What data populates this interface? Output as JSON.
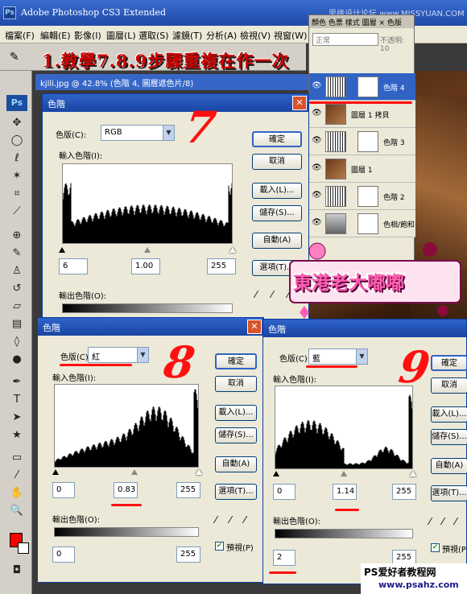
{
  "app": {
    "title": "Adobe Photoshop CS3 Extended",
    "watermark_top": "思缘设计论坛 www.MISSYUAN.COM",
    "ps_logo": "Ps"
  },
  "menu": [
    "檔案(F)",
    "編輯(E)",
    "影像(I)",
    "圖層(L)",
    "選取(S)",
    "濾鏡(T)",
    "分析(A)",
    "檢視(V)",
    "視窗(W)"
  ],
  "banner": "1.教學7.8.9步驟重複在作一次",
  "document": {
    "tab_title": "kjlli.jpg @ 42.8% (色階 4, 圖層遮色片/8)"
  },
  "layers_panel": {
    "tabs": "顏色  色票  樣式  圖層 × 色版",
    "blend_mode": "正常",
    "opacity_label": "不透明: 10",
    "layers": [
      {
        "name": "色階 4",
        "kind": "adjustment",
        "selected": true
      },
      {
        "name": "圖層 1 拷貝",
        "kind": "photo",
        "selected": false
      },
      {
        "name": "色階 3",
        "kind": "adjustment",
        "selected": false
      },
      {
        "name": "圖層 1",
        "kind": "photo",
        "selected": false
      },
      {
        "name": "色階 2",
        "kind": "adjustment",
        "selected": false
      },
      {
        "name": "色相/飽和",
        "kind": "adjustment",
        "selected": false
      }
    ]
  },
  "dialog7": {
    "title": "色階",
    "channel_label": "色版(C):",
    "channel_value": "RGB",
    "input_levels_label": "輸入色階(I):",
    "input_black": "6",
    "input_gamma": "1.00",
    "input_white": "255",
    "output_levels_label": "輸出色階(O):",
    "buttons": {
      "ok": "確定",
      "cancel": "取消",
      "load": "載入(L)...",
      "save": "儲存(S)...",
      "auto": "自動(A)",
      "options": "選項(T)..."
    },
    "step_number": "7"
  },
  "dialog8": {
    "title": "色階",
    "channel_label": "色版(C):",
    "channel_value": "紅",
    "input_levels_label": "輸入色階(I):",
    "input_black": "0",
    "input_gamma": "0.83",
    "input_white": "255",
    "output_levels_label": "輸出色階(O):",
    "output_black": "0",
    "output_white": "255",
    "preview_label": "預視(P)",
    "preview_checked": true,
    "buttons": {
      "ok": "確定",
      "cancel": "取消",
      "load": "載入(L)...",
      "save": "儲存(S)...",
      "auto": "自動(A)",
      "options": "選項(T)..."
    },
    "step_number": "8"
  },
  "dialog9": {
    "title": "色階",
    "channel_label": "色版(C):",
    "channel_value": "藍",
    "input_levels_label": "輸入色階(I):",
    "input_black": "0",
    "input_gamma": "1.14",
    "input_white": "255",
    "output_levels_label": "輸出色階(O):",
    "output_black": "2",
    "output_white": "255",
    "preview_label": "預視(P)",
    "preview_checked": true,
    "buttons": {
      "ok": "確定",
      "cancel": "取消",
      "load": "載入(L)...",
      "save": "儲存(S)...",
      "auto": "自動(A)",
      "options": "選項(T)..."
    },
    "step_number": "9"
  },
  "logo_text": "東港老大嘟嘟",
  "footer": {
    "line1": "PS爱好者教程网",
    "line2": "www.psahz.com"
  },
  "colors": {
    "foreground": "#ff0000",
    "background": "#ffffff",
    "annotation": "#ff1010",
    "title_blue": "#2f63c9"
  }
}
